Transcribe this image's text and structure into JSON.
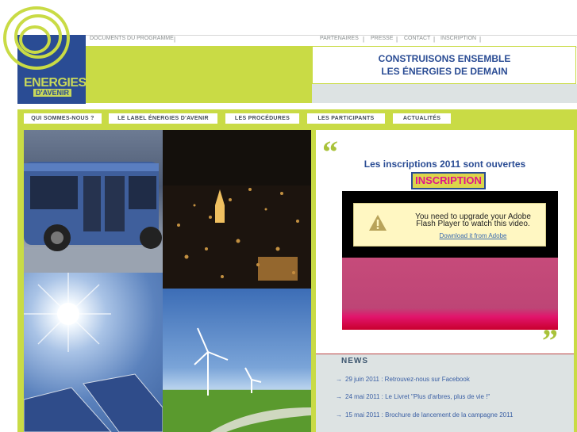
{
  "logo": {
    "line1": "ENERGIES",
    "line2": "D'AVENIR"
  },
  "top_links": {
    "docs": "DOCUMENTS DU PROGRAMME",
    "partners": "PARTENAIRES",
    "press": "PRESSE",
    "contact": "CONTACT",
    "inscription": "INSCRIPTION",
    "separator": "|"
  },
  "header": {
    "line1": "CONSTRUISONS ENSEMBLE",
    "line2": "LES ÉNERGIES DE DEMAIN"
  },
  "nav": [
    {
      "label": "QUI SOMMES-NOUS ?"
    },
    {
      "label": "LE LABEL ÉNERGIES D'AVENIR"
    },
    {
      "label": "LES PROCÉDURES"
    },
    {
      "label": "LES PARTICIPANTS"
    },
    {
      "label": "ACTUALITÉS"
    }
  ],
  "announcement": {
    "text": "Les inscriptions 2011 sont ouvertes",
    "button": "INSCRIPTION"
  },
  "flash": {
    "line1": "You need to upgrade your Adobe",
    "line2": "Flash Player to watch this video.",
    "link": "Download it from Adobe"
  },
  "news": {
    "title": "NEWS",
    "items": [
      {
        "text": "29 juin 2011 : Retrouvez-nous sur Facebook"
      },
      {
        "text": "24 mai 2011 : Le Livret \"Plus d'arbres, plus de vie !\""
      },
      {
        "text": "15 mai 2011 : Brochure de lancement de la campagne 2011"
      }
    ]
  },
  "colors": {
    "brand_blue": "#2a4c94",
    "lime": "#c9db45",
    "magenta": "#e0148a"
  }
}
